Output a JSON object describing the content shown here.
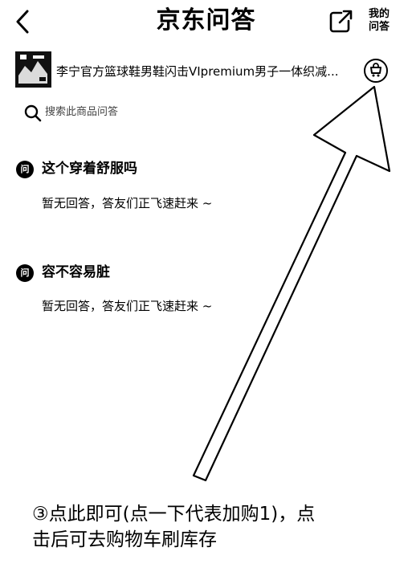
{
  "header": {
    "title": "京东问答",
    "my_qa_line1": "我的",
    "my_qa_line2": "问答"
  },
  "product": {
    "title": "李宁官方篮球鞋男鞋闪击VIpremium男子一体织减..."
  },
  "search": {
    "placeholder": "搜索此商品问答"
  },
  "questions": [
    {
      "badge": "问",
      "question": "这个穿着舒服吗",
      "answer": "暂无回答，答友们正飞速赶来 ~"
    },
    {
      "badge": "问",
      "question": "容不容易脏",
      "answer": "暂无回答，答友们正飞速赶来 ~"
    }
  ],
  "annotation": {
    "line1": "③点此即可(点一下代表加购1)，点",
    "line2": "击后可去购物车刷库存"
  },
  "icons": {
    "back": "chevron-left-icon",
    "share": "share-icon",
    "cart": "cart-icon",
    "search": "search-icon"
  }
}
